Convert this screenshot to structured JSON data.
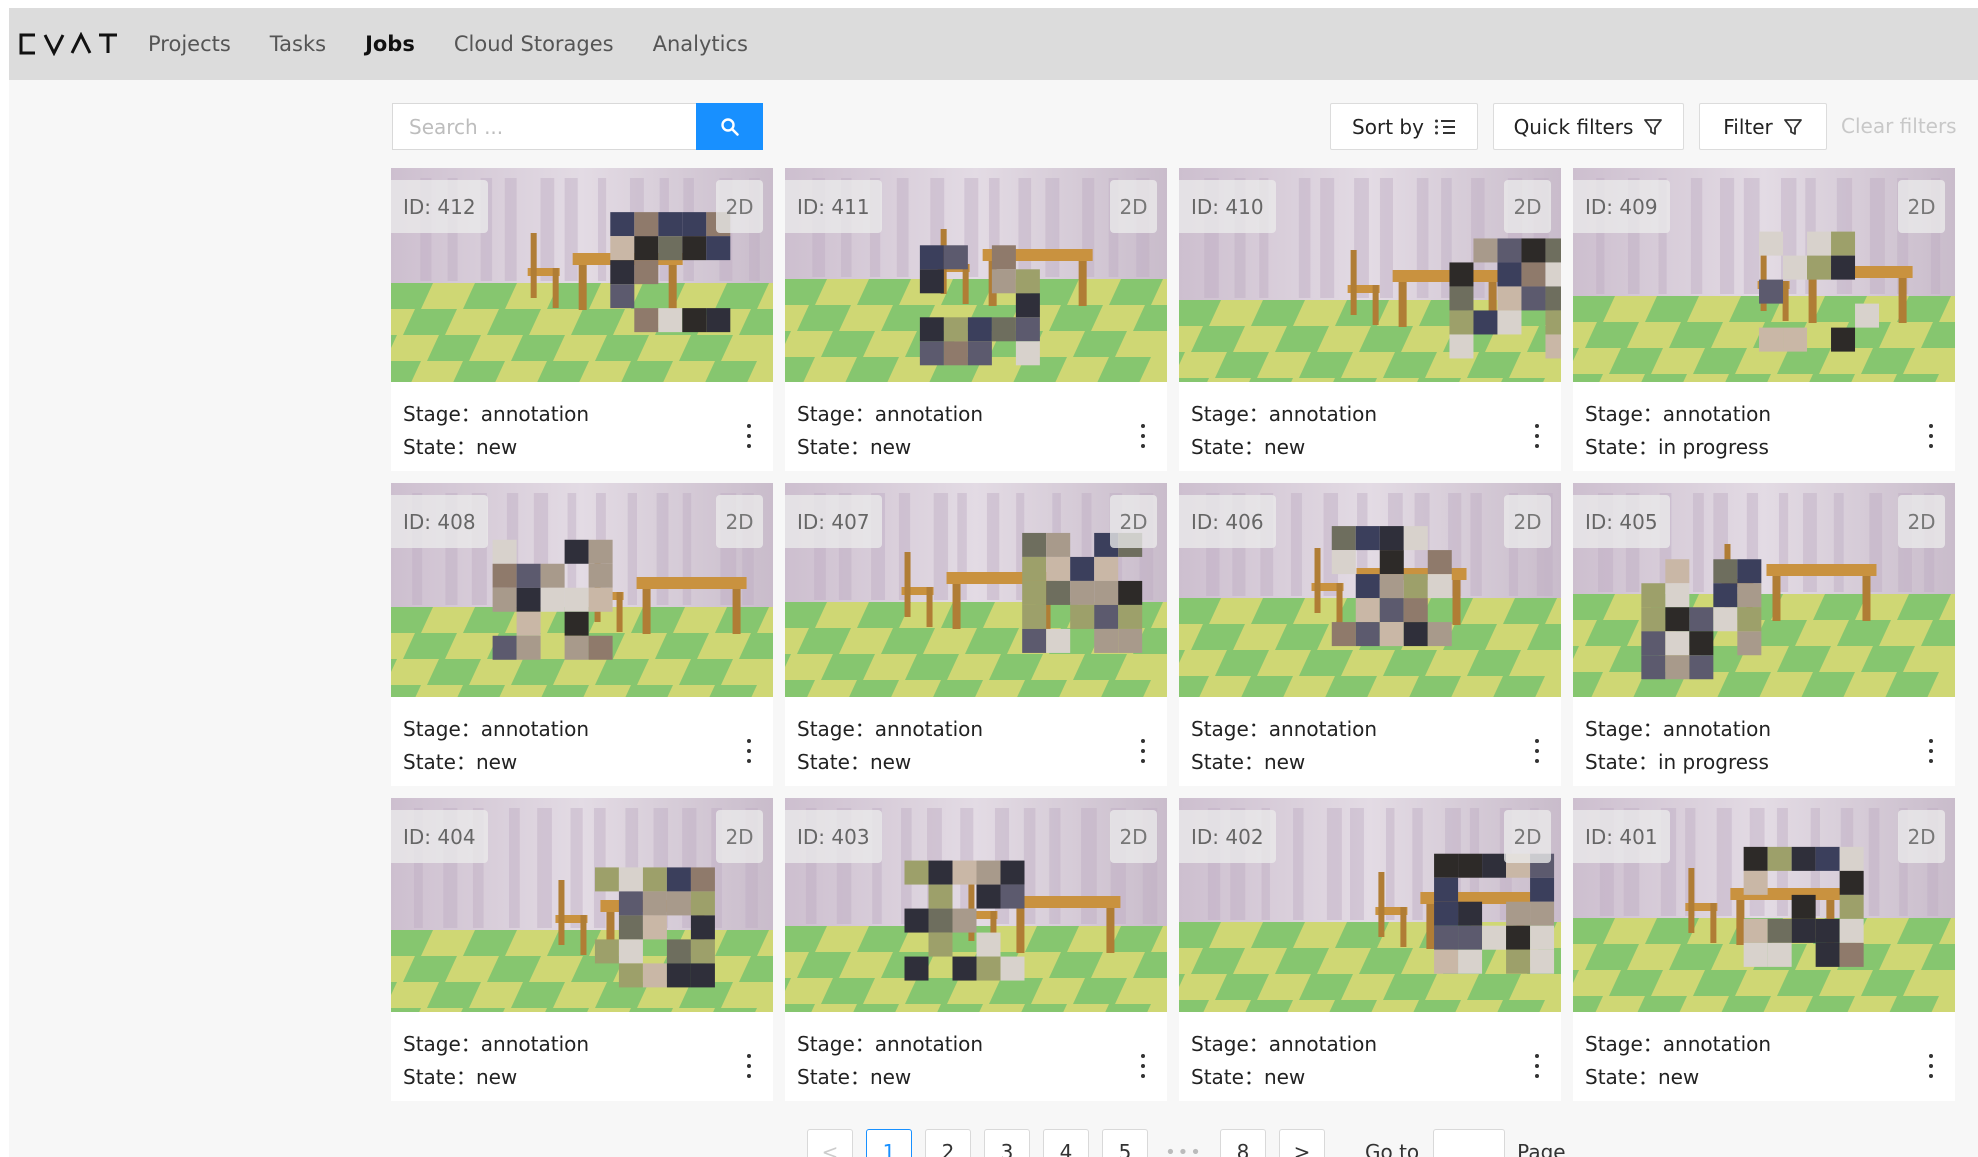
{
  "header": {
    "logo": "CVAT",
    "nav": [
      {
        "label": "Projects",
        "active": false
      },
      {
        "label": "Tasks",
        "active": false
      },
      {
        "label": "Jobs",
        "active": true
      },
      {
        "label": "Cloud Storages",
        "active": false
      },
      {
        "label": "Analytics",
        "active": false
      }
    ]
  },
  "toolbar": {
    "search_placeholder": "Search ...",
    "search_icon": "search-icon",
    "sort_label": "Sort by",
    "sort_icon": "sort-list-icon",
    "quick_filters_label": "Quick filters",
    "filter_label": "Filter",
    "filter_icon": "funnel-icon",
    "clear_filters_label": "Clear filters"
  },
  "colors": {
    "accent": "#1890ff",
    "header_bg": "#dcdcdc"
  },
  "stage_label": "Stage：",
  "state_label": "State：",
  "jobs": [
    {
      "id": "ID: 412",
      "dim": "2D",
      "stage": "annotation",
      "state": "new"
    },
    {
      "id": "ID: 411",
      "dim": "2D",
      "stage": "annotation",
      "state": "new"
    },
    {
      "id": "ID: 410",
      "dim": "2D",
      "stage": "annotation",
      "state": "new"
    },
    {
      "id": "ID: 409",
      "dim": "2D",
      "stage": "annotation",
      "state": "in progress"
    },
    {
      "id": "ID: 408",
      "dim": "2D",
      "stage": "annotation",
      "state": "new"
    },
    {
      "id": "ID: 407",
      "dim": "2D",
      "stage": "annotation",
      "state": "new"
    },
    {
      "id": "ID: 406",
      "dim": "2D",
      "stage": "annotation",
      "state": "new"
    },
    {
      "id": "ID: 405",
      "dim": "2D",
      "stage": "annotation",
      "state": "in progress"
    },
    {
      "id": "ID: 404",
      "dim": "2D",
      "stage": "annotation",
      "state": "new"
    },
    {
      "id": "ID: 403",
      "dim": "2D",
      "stage": "annotation",
      "state": "new"
    },
    {
      "id": "ID: 402",
      "dim": "2D",
      "stage": "annotation",
      "state": "new"
    },
    {
      "id": "ID: 401",
      "dim": "2D",
      "stage": "annotation",
      "state": "new"
    }
  ],
  "pagination": {
    "prev": "<",
    "pages": [
      "1",
      "2",
      "3",
      "4",
      "5"
    ],
    "ellipsis": "•••",
    "last": "8",
    "next": ">",
    "current": "1",
    "goto_label": "Go to",
    "page_label": "Page"
  }
}
